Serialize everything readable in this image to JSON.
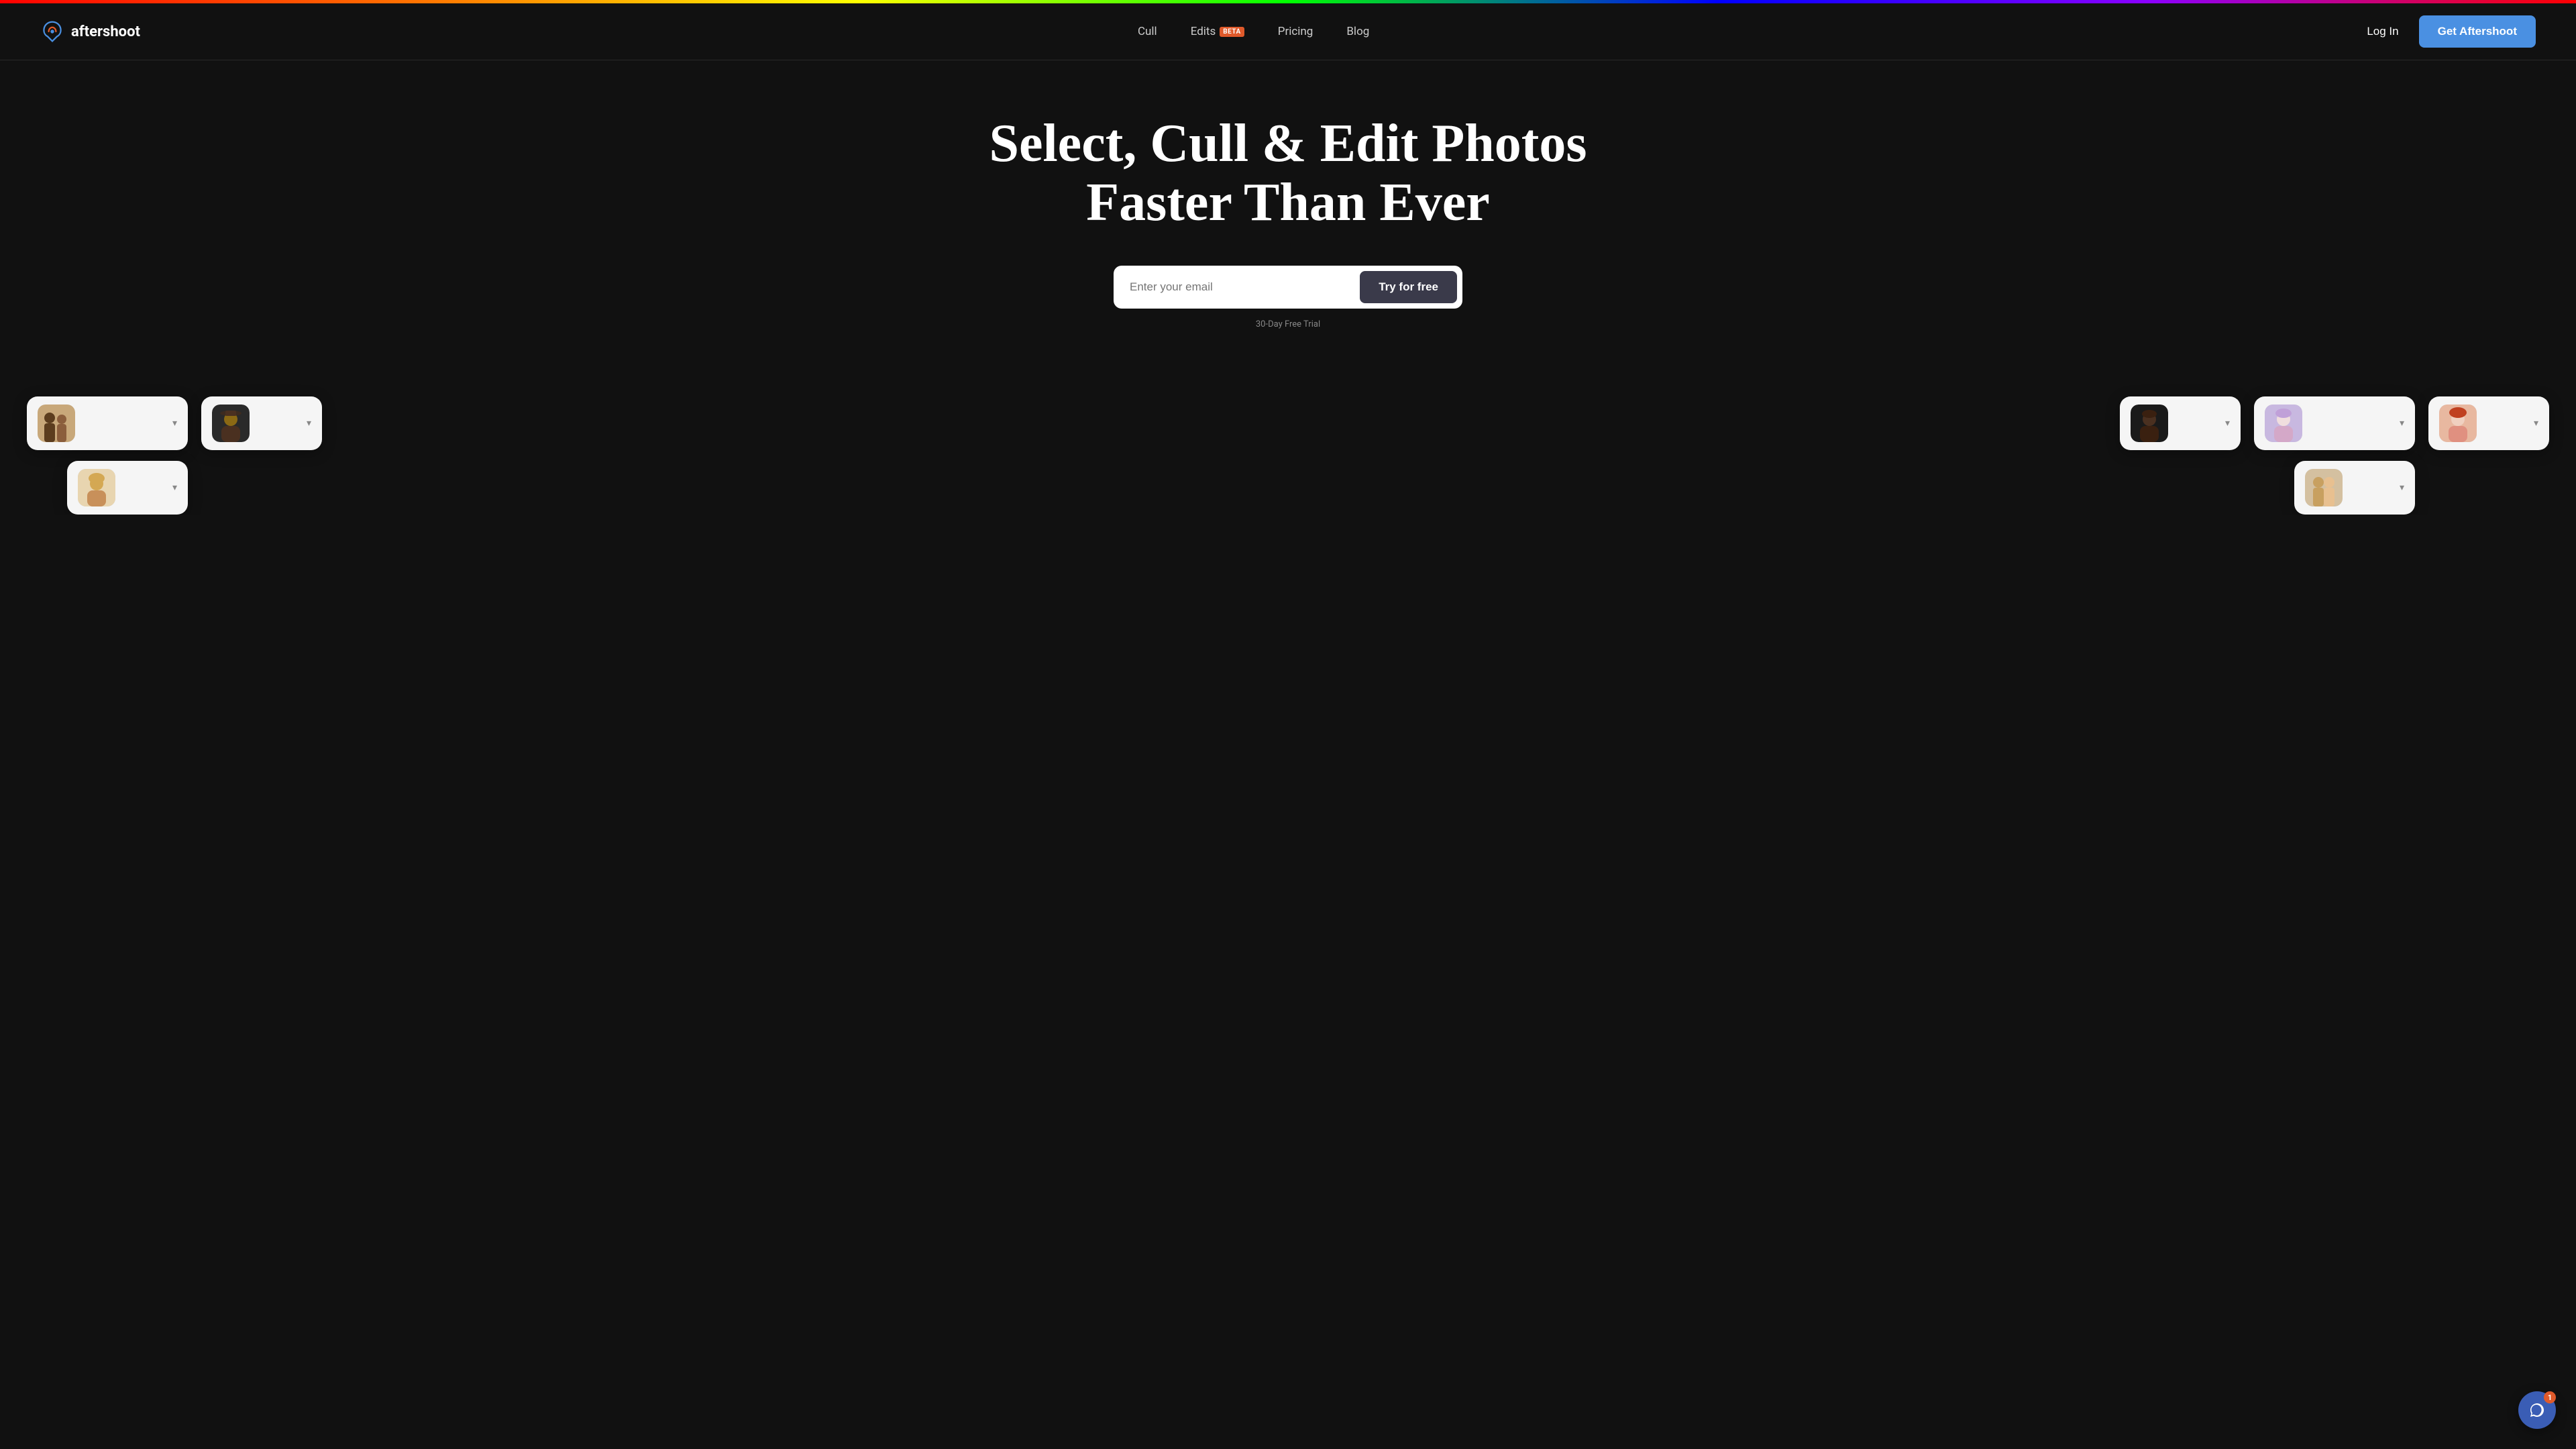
{
  "rainbow_bar": true,
  "navbar": {
    "logo_text_before": "after",
    "logo_text_after": "shoot",
    "links": [
      {
        "id": "cull",
        "label": "Cull",
        "badge": null
      },
      {
        "id": "edits",
        "label": "Edits",
        "badge": "BETA"
      },
      {
        "id": "pricing",
        "label": "Pricing",
        "badge": null
      },
      {
        "id": "blog",
        "label": "Blog",
        "badge": null
      }
    ],
    "login_label": "Log In",
    "cta_label": "Get Aftershoot"
  },
  "hero": {
    "title_line1": "Select, Cull & Edit Photos",
    "title_line2": "Faster Than Ever",
    "email_placeholder": "Enter your email",
    "cta_button": "Try for free",
    "trial_note": "30-Day Free Trial"
  },
  "photo_cards": [
    {
      "id": "card-1",
      "position": "top-left",
      "visible": true,
      "avatar_color": "brown"
    },
    {
      "id": "card-2",
      "position": "top-left-lower",
      "visible": true,
      "avatar_color": "blonde"
    },
    {
      "id": "card-3",
      "position": "top-center-left",
      "visible": true,
      "avatar_color": "dark"
    },
    {
      "id": "card-4",
      "position": "top-center-right",
      "visible": true,
      "avatar_color": "dark-man"
    },
    {
      "id": "card-5",
      "position": "top-right-left",
      "visible": true,
      "avatar_color": "lavender"
    },
    {
      "id": "card-6",
      "position": "top-right",
      "visible": true,
      "avatar_color": "couple"
    },
    {
      "id": "card-7",
      "position": "bottom-right",
      "visible": true,
      "avatar_color": "redhead"
    }
  ],
  "chat": {
    "badge_count": "1",
    "aria_label": "Open chat"
  },
  "colors": {
    "background": "#111111",
    "nav_border": "#2a2a2a",
    "accent_blue": "#4a90e2",
    "beta_badge": "#e05a2b",
    "btn_dark": "#3a3a4a",
    "text_muted": "#888888",
    "card_bg": "#f5f5f5"
  }
}
